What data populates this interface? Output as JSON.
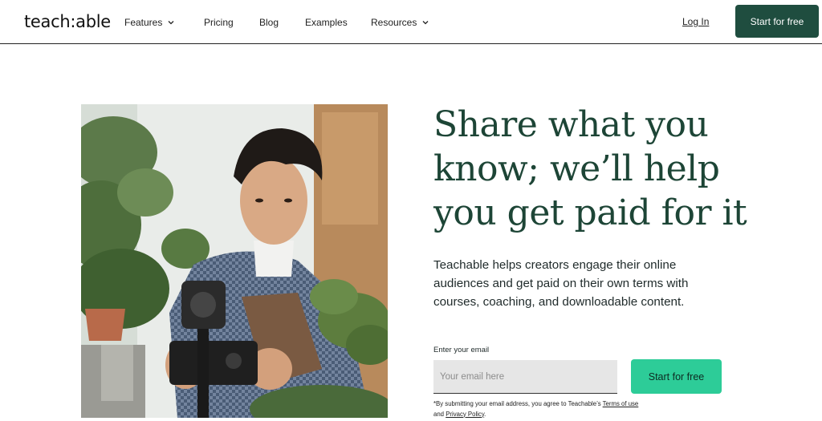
{
  "nav": {
    "logo": "teach:able",
    "items": [
      {
        "label": "Features",
        "has_dropdown": true
      },
      {
        "label": "Pricing",
        "has_dropdown": false
      },
      {
        "label": "Blog",
        "has_dropdown": false
      },
      {
        "label": "Examples",
        "has_dropdown": false
      },
      {
        "label": "Resources",
        "has_dropdown": true
      }
    ],
    "login_label": "Log In",
    "cta_label": "Start for free"
  },
  "hero": {
    "headline": "Share what you know; we’ll help you get paid for it",
    "subtext": "Teachable helps creators engage their online audiences and get paid on their own terms with courses, coaching, and downloadable content.",
    "email_label": "Enter your email",
    "email_placeholder": "Your email here",
    "email_value": "",
    "cta_label": "Start for free",
    "disclaimer_prefix": "*By submitting your email address, you agree to Teachable’s ",
    "terms_label": "Terms of use",
    "disclaimer_and": " and ",
    "privacy_label": "Privacy Policy",
    "disclaimer_suffix": "."
  },
  "colors": {
    "brand_dark_green": "#1f4d3f",
    "headline_green": "#1d4536",
    "cta_mint": "#2dcc98"
  }
}
